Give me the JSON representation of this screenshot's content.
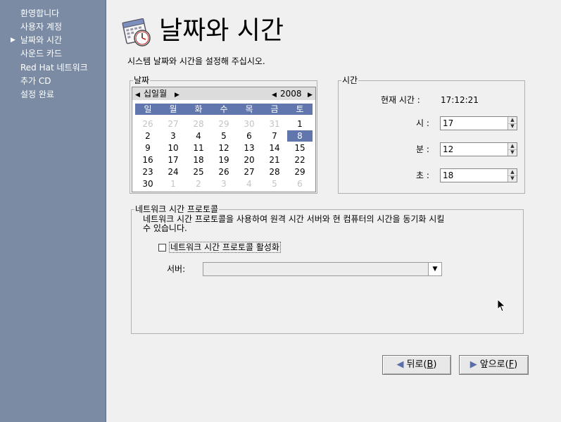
{
  "sidebar": {
    "items": [
      {
        "label": "환영합니다"
      },
      {
        "label": "사용자 계정"
      },
      {
        "label": "날짜와 시간"
      },
      {
        "label": "사운드 카드"
      },
      {
        "label": "Red Hat 네트워크"
      },
      {
        "label": "추가 CD"
      },
      {
        "label": "설정 완료"
      }
    ],
    "current_index": 2
  },
  "header": {
    "icon": "calendar-clock-icon",
    "title": "날짜와 시간",
    "subtitle": "시스템 날짜와 시간을 설정해 주십시오."
  },
  "date": {
    "frame_label": "날짜",
    "month": "십일월",
    "year": "2008",
    "weekdays": [
      "일",
      "월",
      "화",
      "수",
      "목",
      "금",
      "토"
    ],
    "weeks": [
      [
        "26",
        "27",
        "28",
        "29",
        "30",
        "31",
        "1"
      ],
      [
        "2",
        "3",
        "4",
        "5",
        "6",
        "7",
        "8"
      ],
      [
        "9",
        "10",
        "11",
        "12",
        "13",
        "14",
        "15"
      ],
      [
        "16",
        "17",
        "18",
        "19",
        "20",
        "21",
        "22"
      ],
      [
        "23",
        "24",
        "25",
        "26",
        "27",
        "28",
        "29"
      ],
      [
        "30",
        "1",
        "2",
        "3",
        "4",
        "5",
        "6"
      ]
    ],
    "selected_day": "8"
  },
  "time": {
    "frame_label": "시간",
    "current_label": "현재 시간 :",
    "current_value": "17:12:21",
    "hour_label": "시 :",
    "hour_value": "17",
    "minute_label": "분 :",
    "minute_value": "12",
    "second_label": "초 :",
    "second_value": "18"
  },
  "ntp": {
    "frame_label": "네트워크 시간 프로토콜",
    "description": "네트워크 시간 프로토콜을 사용하여 원격 시간 서버와 현 컴퓨터의 시간을 동기화 시킬 수 있습니다.",
    "enable_label": "네트워크 시간 프로토콜 활성화",
    "enabled": false,
    "server_label": "서버:",
    "server_value": ""
  },
  "buttons": {
    "back_label": "뒤로(",
    "back_mnemonic": "B",
    "forward_label": "앞으로(",
    "forward_mnemonic": "F",
    "close_paren": ")"
  },
  "colors": {
    "sidebar_bg": "#7b8ba3",
    "accent": "#6076ac",
    "window_bg": "#f0f0f0"
  }
}
